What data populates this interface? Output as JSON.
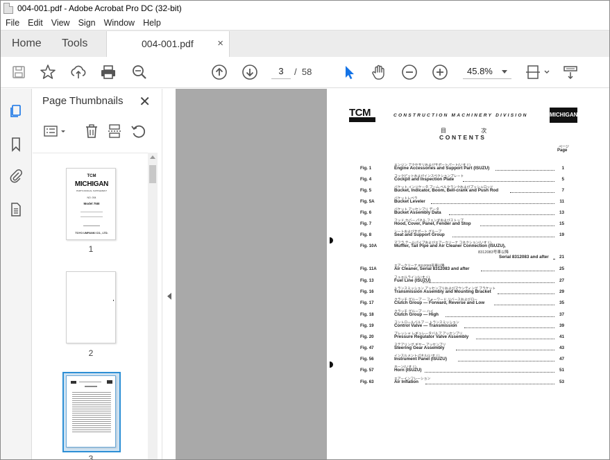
{
  "window": {
    "title": "004-001.pdf - Adobe Acrobat Pro DC (32-bit)"
  },
  "menu": [
    "File",
    "Edit",
    "View",
    "Sign",
    "Window",
    "Help"
  ],
  "tabs": {
    "home": "Home",
    "tools": "Tools",
    "document": "004-001.pdf",
    "close": "×"
  },
  "toolbar": {
    "current_page": "3",
    "page_separator": "/",
    "total_pages": "58",
    "zoom": "45.8%",
    "icons": [
      "save-icon",
      "bookmark-star-icon",
      "upload-icon",
      "print-icon",
      "zoom-search-icon",
      "page-up-icon",
      "page-down-icon",
      "select-pointer-icon",
      "hand-icon",
      "zoom-out-icon",
      "zoom-in-icon",
      "fit-page-icon",
      "scroll-mode-icon"
    ]
  },
  "thumbnails": {
    "title": "Page Thumbnails",
    "close": "✕",
    "pages": [
      {
        "number": "1"
      },
      {
        "number": "2"
      },
      {
        "number": "3",
        "selected": true
      }
    ],
    "cover": {
      "brand": "TCM",
      "name": "MICHIGAN",
      "subtitle": "PARTS MANUAL SUPPLEMENT",
      "number": "NO. 004",
      "model": "Model 75III",
      "footer": "TOYO UMPANKI CO., LTD."
    }
  },
  "page": {
    "brand": "TCM",
    "division": "CONSTRUCTION MACHINERY DIVISION",
    "logo": "MICHIGAN",
    "heading_jp": "目 次",
    "heading": "CONTENTS",
    "page_label_jp": "ページ",
    "page_label": "Page",
    "toc": [
      {
        "fig": "Fig. 1",
        "jp": "エンジン アクセサリおよびサポートパート(いすゞ)",
        "en": "Engine Accessories and Support Part (ISUZU)",
        "page": "1"
      },
      {
        "fig": "Fig. 4",
        "jp": "コックピットおよびインスペクションプレート",
        "en": "Cockpit and Inspection Plate",
        "page": "5"
      },
      {
        "fig": "Fig. 5",
        "jp": "バケット,インジケータ,ブーム,ベルクランクおよびプッシュロッド",
        "en": "Bucket, Indicator, Boom, Bell-crank and Push Rod",
        "page": "7"
      },
      {
        "fig": "Fig. 5A",
        "jp": "バケットレベラ",
        "en": "Bucket Leveler",
        "page": "11"
      },
      {
        "fig": "Fig. 6",
        "jp": "バケット アッセンブリ データ",
        "en": "Bucket Assembly Data",
        "page": "13"
      },
      {
        "fig": "Fig. 7",
        "jp": "フッド,カバー,パネル,フェンダおよびストップ",
        "en": "Hood, Cover, Panel, Fender and Stop",
        "page": "15"
      },
      {
        "fig": "Fig. 8",
        "jp": "シートおよびサポート グループ",
        "en": "Seat and Support Group",
        "page": "19"
      },
      {
        "fig": "Fig. 10A",
        "jp": "マフラ,テールパイプおよびエアークリーナ コネクション(いすゞ),",
        "en": "Muffler, Tail Pipe and Air Cleaner Connection (ISUZU),",
        "extra_jp": "8312083号車以降",
        "extra_en": "Serial 8312083 and after",
        "page": "21"
      },
      {
        "fig": "Fig. 11A",
        "jp": "エアークリーナ,8312083号車以降",
        "en": "Air Cleaner, Serial 8312083 and after",
        "page": "25"
      },
      {
        "fig": "Fig. 13",
        "jp": "フュエルライン(いすゞ)",
        "en": "Fuel Line (ISUZU)",
        "page": "27"
      },
      {
        "fig": "Fig. 16",
        "jp": "トランスミッション アッセンブリおよびマウンティング ブラケット",
        "en": "Transmission Assembly and Mounting Bracket",
        "page": "29"
      },
      {
        "fig": "Fig. 17",
        "jp": "クラッチ グループ — フォーワード,リバースおよびロー",
        "en": "Clutch Group — Forward, Reverse and Low",
        "page": "35"
      },
      {
        "fig": "Fig. 18",
        "jp": "クラッチ グループ — ハイ",
        "en": "Clutch Group — High",
        "page": "37"
      },
      {
        "fig": "Fig. 19",
        "jp": "コントロールバルブ — トランスミッション",
        "en": "Control Valve — Transmission",
        "page": "39"
      },
      {
        "fig": "Fig. 20",
        "jp": "プレッシャ レギュレータバルブ アッセンブリ",
        "en": "Pressure Regulator Valve Assembly",
        "page": "41"
      },
      {
        "fig": "Fig. 47",
        "jp": "ステアリング ギヤー アッセンブリ",
        "en": "Steering Gear Assembly",
        "page": "43"
      },
      {
        "fig": "Fig. 56",
        "jp": "インスルメントパネル(いすゞ)",
        "en": "Instrument Panel (ISUZU)",
        "page": "47"
      },
      {
        "fig": "Fig. 57",
        "jp": "ホーン(いすゞ)",
        "en": "Horn (ISUZU)",
        "page": "51"
      },
      {
        "fig": "Fig. 63",
        "jp": "エアーインフレーション",
        "en": "Air Inflation",
        "page": "53"
      }
    ]
  },
  "colors": {
    "accent": "#1473e6",
    "doc_background": "#a9a9a9",
    "selected_thumb": "#2d8fd5"
  }
}
